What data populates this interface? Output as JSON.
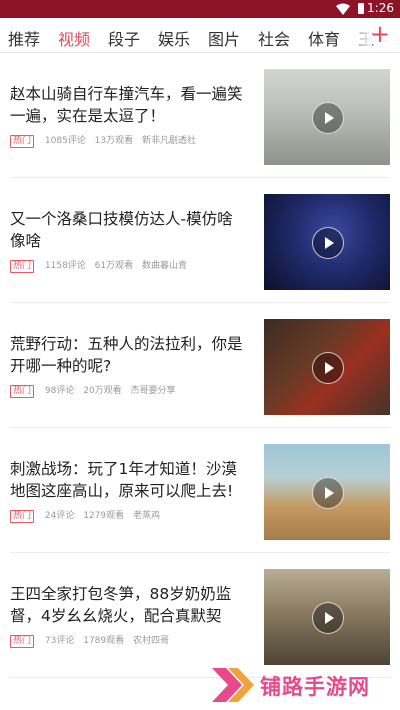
{
  "status_bar": {
    "time": "1:26"
  },
  "tabs": {
    "items": [
      "推荐",
      "视频",
      "段子",
      "娱乐",
      "图片",
      "社会",
      "体育",
      "王"
    ],
    "active": "视频"
  },
  "feed": [
    {
      "title": "赵本山骑自行车撞汽车，看一遍笑一遍，实在是太逗了！",
      "tag": "热门",
      "comments": "1085评论",
      "views": "13万观看",
      "source": "新非凡剧透社",
      "thumb_colors": [
        "#b9bdb7",
        "#8d948b"
      ]
    },
    {
      "title": "又一个洛桑口技模仿达人-模仿啥像啥",
      "tag": "热门",
      "comments": "1158评论",
      "views": "61万观看",
      "source": "数曲暮山青",
      "thumb_colors": [
        "#1f2a6a",
        "#0c0f2a"
      ]
    },
    {
      "title": "荒野行动：五种人的法拉利，你是开哪一种的呢?",
      "tag": "热门",
      "comments": "98评论",
      "views": "20万观看",
      "source": "杰哥要分享",
      "thumb_colors": [
        "#44332a",
        "#9a3020"
      ]
    },
    {
      "title": "刺激战场：玩了1年才知道！沙漠地图这座高山，原来可以爬上去!",
      "tag": "热门",
      "comments": "24评论",
      "views": "1279观看",
      "source": "老蒸鸡",
      "thumb_colors": [
        "#9cc6d8",
        "#c59a62"
      ]
    },
    {
      "title": "王四全家打包冬笋，88岁奶奶监督，4岁幺幺烧火，配合真默契",
      "tag": "热门",
      "comments": "73评论",
      "views": "1789观看",
      "source": "农村四哥",
      "thumb_colors": [
        "#8a7a60",
        "#4c4436"
      ]
    }
  ],
  "watermark": {
    "text": "铺路手游网"
  },
  "colors": {
    "status_bar": "#8c1426",
    "accent": "#e84a55",
    "tag": "#e85a63"
  }
}
